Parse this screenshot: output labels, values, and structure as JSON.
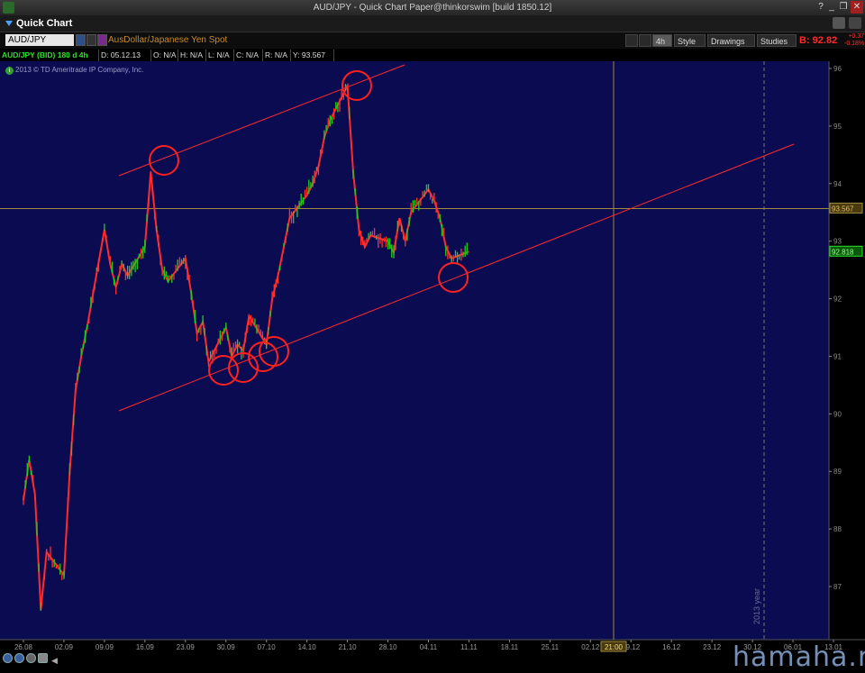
{
  "window": {
    "title": "AUD/JPY - Quick Chart Paper@thinkorswim [build 1850.12]",
    "controls": [
      "?",
      "_",
      "❐",
      "✕"
    ]
  },
  "panel": {
    "name": "Quick Chart"
  },
  "toolbar": {
    "symbol": "AUD/JPY",
    "description": "AusDollar/Japanese Yen Spot",
    "aggregation": "4h",
    "style_label": "Style",
    "drawings_label": "Drawings",
    "studies_label": "Studies",
    "bid": "B: 92.82",
    "change_top": "+0.37",
    "change_bottom": "-0.18%"
  },
  "info": {
    "symbol_spec": "AUD/JPY (BID) 180 d 4h",
    "date": "D: 05.12.13 21:00",
    "open": "O: N/A",
    "high": "H: N/A",
    "low": "L: N/A",
    "close": "C: N/A",
    "range": "R: N/A",
    "y": "Y: 93.567"
  },
  "copyright": "2013 © TD Ameritrade IP Company, Inc.",
  "chart_data": {
    "type": "line",
    "title": "",
    "x_ticks": [
      "26.08",
      "02.09",
      "09.09",
      "16.09",
      "23.09",
      "30.09",
      "07.10",
      "14.10",
      "21.10",
      "28.10",
      "04.11",
      "11.11",
      "18.11",
      "25.11",
      "02.12",
      "09.12",
      "16.12",
      "23.12",
      "30.12",
      "06.01",
      "13.01"
    ],
    "y_ticks": [
      87,
      88,
      89,
      90,
      91,
      92,
      93,
      94,
      95,
      96
    ],
    "ylim": [
      86.5,
      96.2
    ],
    "cursor_price_label": "93.567",
    "last_price_label": "92.818",
    "cursor_time_label": "21:00",
    "year_label": "2013 year",
    "grid": false,
    "series": [
      {
        "color": "#ff2020",
        "x": [
          "26.08",
          "27.08",
          "28.08",
          "29.08",
          "30.08",
          "02.09",
          "03.09",
          "04.09",
          "05.09",
          "06.09",
          "09.09",
          "10.09",
          "11.09",
          "12.09",
          "13.09",
          "16.09",
          "17.09",
          "18.09",
          "19.09",
          "20.09",
          "23.09",
          "24.09",
          "25.09",
          "26.09",
          "27.09",
          "30.09",
          "01.10",
          "02.10",
          "03.10",
          "04.10",
          "07.10",
          "08.10",
          "09.10",
          "10.10",
          "11.10",
          "14.10",
          "15.10",
          "16.10",
          "17.10",
          "18.10",
          "21.10",
          "22.10",
          "23.10",
          "24.10",
          "25.10",
          "28.10",
          "29.10",
          "30.10",
          "31.10",
          "01.11",
          "04.11",
          "05.11",
          "06.11",
          "07.11",
          "08.11",
          "11.11"
        ],
        "y": [
          88.5,
          89.2,
          88.6,
          86.6,
          87.6,
          87.2,
          89.0,
          90.4,
          91.0,
          91.5,
          93.2,
          92.6,
          92.2,
          92.6,
          92.4,
          92.9,
          94.2,
          93.2,
          92.5,
          92.3,
          92.7,
          92.1,
          91.4,
          91.6,
          90.9,
          91.5,
          91.0,
          91.2,
          91.1,
          91.7,
          91.2,
          92.0,
          92.4,
          92.9,
          93.4,
          93.8,
          94.0,
          94.3,
          94.8,
          95.1,
          95.7,
          94.2,
          93.2,
          92.9,
          93.1,
          93.0,
          92.8,
          93.4,
          93.0,
          93.5,
          93.9,
          93.7,
          93.4,
          92.9,
          92.7,
          92.82
        ]
      }
    ],
    "annotations": {
      "trend_lines": 2,
      "circles": 7
    }
  }
}
